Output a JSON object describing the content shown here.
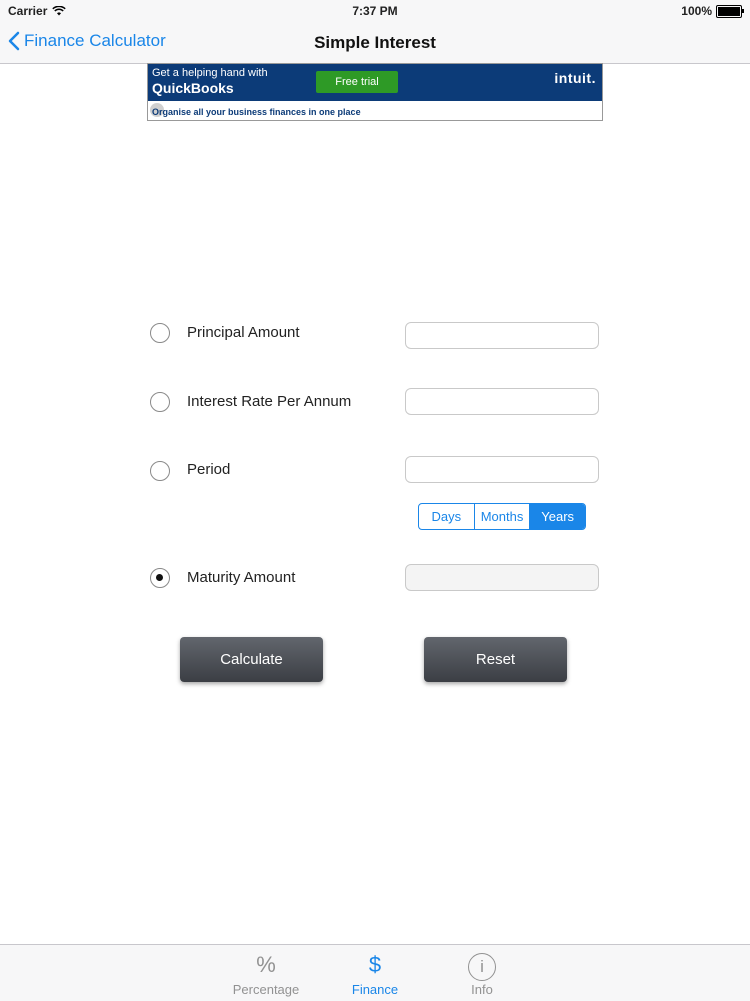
{
  "status_bar": {
    "carrier": "Carrier",
    "time": "7:37 PM",
    "battery": "100%"
  },
  "nav": {
    "back_label": "Finance Calculator",
    "title": "Simple Interest"
  },
  "ad": {
    "tagline": "Get a helping hand with",
    "brand": "QuickBooks",
    "cta": "Free trial",
    "logo": "intuit.",
    "subtext": "Organise all your business finances in one place"
  },
  "form": {
    "rows": [
      {
        "label": "Principal Amount",
        "value": "",
        "selected": false
      },
      {
        "label": "Interest Rate Per Annum",
        "value": "",
        "selected": false
      },
      {
        "label": "Period",
        "value": "",
        "selected": false
      },
      {
        "label": "Maturity Amount",
        "value": "",
        "selected": true
      }
    ],
    "period_units": [
      "Days",
      "Months",
      "Years"
    ],
    "selected_unit": "Years"
  },
  "buttons": {
    "calculate": "Calculate",
    "reset": "Reset"
  },
  "tabbar": {
    "tabs": [
      {
        "label": "Percentage",
        "icon": "%"
      },
      {
        "label": "Finance",
        "icon": "$"
      },
      {
        "label": "Info",
        "icon": "i"
      }
    ],
    "active": "Finance"
  },
  "colors": {
    "accent": "#1a86e8",
    "ad_blue": "#0c3b78",
    "ad_green": "#2e9a26",
    "button_dark": "#3b3e44"
  }
}
